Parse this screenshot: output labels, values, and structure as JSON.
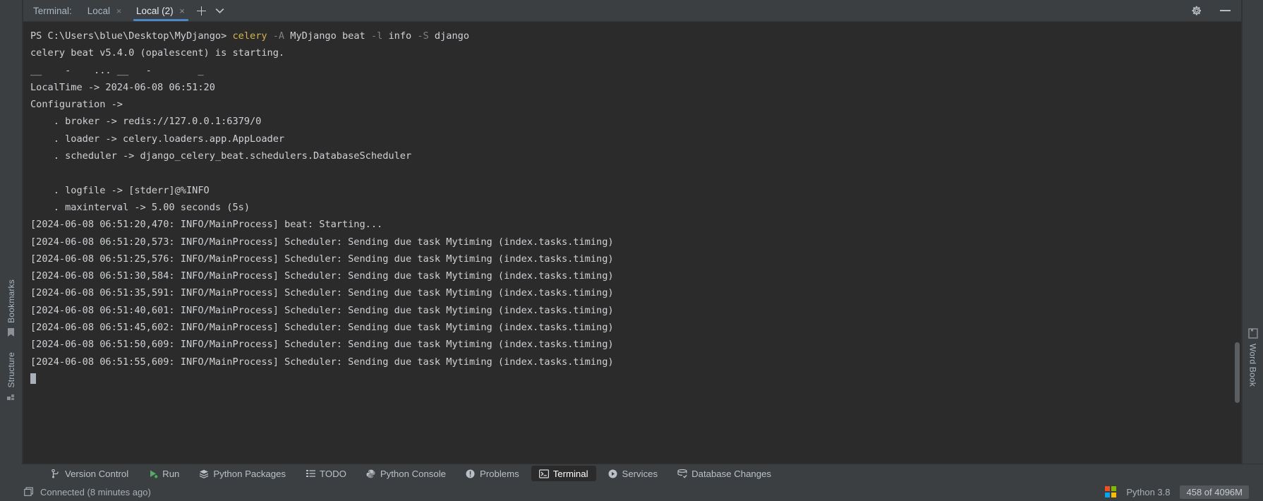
{
  "terminal_header": {
    "label": "Terminal:",
    "tabs": [
      {
        "name": "Local",
        "active": false,
        "close_glyph": "×"
      },
      {
        "name": "Local (2)",
        "active": true,
        "close_glyph": "×"
      }
    ],
    "add_tab_glyph": "+",
    "dropdown_glyph": "⌄",
    "settings_icon": "gear-icon",
    "minimize_glyph": "—"
  },
  "terminal": {
    "prompt_path": "PS C:\\Users\\blue\\Desktop\\MyDjango>",
    "command": {
      "name": "celery",
      "args": " MyDjango beat ",
      "flag_a": "-A",
      "flag_l": "-l",
      "mid": " info ",
      "flag_s": "-S",
      "tail": " django"
    },
    "lines": [
      "celery beat v5.4.0 (opalescent) is starting.",
      "__    -    ... __   -        _",
      "LocalTime -> 2024-06-08 06:51:20",
      "Configuration ->",
      "    . broker -> redis://127.0.0.1:6379/0",
      "    . loader -> celery.loaders.app.AppLoader",
      "    . scheduler -> django_celery_beat.schedulers.DatabaseScheduler",
      "",
      "    . logfile -> [stderr]@%INFO",
      "    . maxinterval -> 5.00 seconds (5s)",
      "[2024-06-08 06:51:20,470: INFO/MainProcess] beat: Starting...",
      "[2024-06-08 06:51:20,573: INFO/MainProcess] Scheduler: Sending due task Mytiming (index.tasks.timing)",
      "[2024-06-08 06:51:25,576: INFO/MainProcess] Scheduler: Sending due task Mytiming (index.tasks.timing)",
      "[2024-06-08 06:51:30,584: INFO/MainProcess] Scheduler: Sending due task Mytiming (index.tasks.timing)",
      "[2024-06-08 06:51:35,591: INFO/MainProcess] Scheduler: Sending due task Mytiming (index.tasks.timing)",
      "[2024-06-08 06:51:40,601: INFO/MainProcess] Scheduler: Sending due task Mytiming (index.tasks.timing)",
      "[2024-06-08 06:51:45,602: INFO/MainProcess] Scheduler: Sending due task Mytiming (index.tasks.timing)",
      "[2024-06-08 06:51:50,609: INFO/MainProcess] Scheduler: Sending due task Mytiming (index.tasks.timing)",
      "[2024-06-08 06:51:55,609: INFO/MainProcess] Scheduler: Sending due task Mytiming (index.tasks.timing)"
    ]
  },
  "left_rail": {
    "bookmarks_label": "Bookmarks",
    "structure_label": "Structure"
  },
  "right_rail": {
    "word_book_label": "Word Book"
  },
  "tool_buttons": [
    {
      "label": "Version Control",
      "icon": "branch-icon",
      "active": false
    },
    {
      "label": "Run",
      "icon": "run-icon",
      "active": false
    },
    {
      "label": "Python Packages",
      "icon": "packages-icon",
      "active": false
    },
    {
      "label": "TODO",
      "icon": "list-icon",
      "active": false
    },
    {
      "label": "Python Console",
      "icon": "python-icon",
      "active": false
    },
    {
      "label": "Problems",
      "icon": "warning-icon",
      "active": false
    },
    {
      "label": "Terminal",
      "icon": "terminal-icon",
      "active": true
    },
    {
      "label": "Services",
      "icon": "play-circle-icon",
      "active": false
    },
    {
      "label": "Database Changes",
      "icon": "database-icon",
      "active": false
    }
  ],
  "status_bar": {
    "connection_icon": "window-icon",
    "connection_text": "Connected (8 minutes ago)",
    "platform_icon": "windows-logo-icon",
    "interpreter": "Python 3.8",
    "memory": "458 of 4096M"
  },
  "colors": {
    "accent": "#4a88c7",
    "command": "#d6b44c",
    "terminal_bg": "#2b2b2b",
    "chrome_bg": "#3c3f41",
    "text": "#a9b7c6"
  }
}
